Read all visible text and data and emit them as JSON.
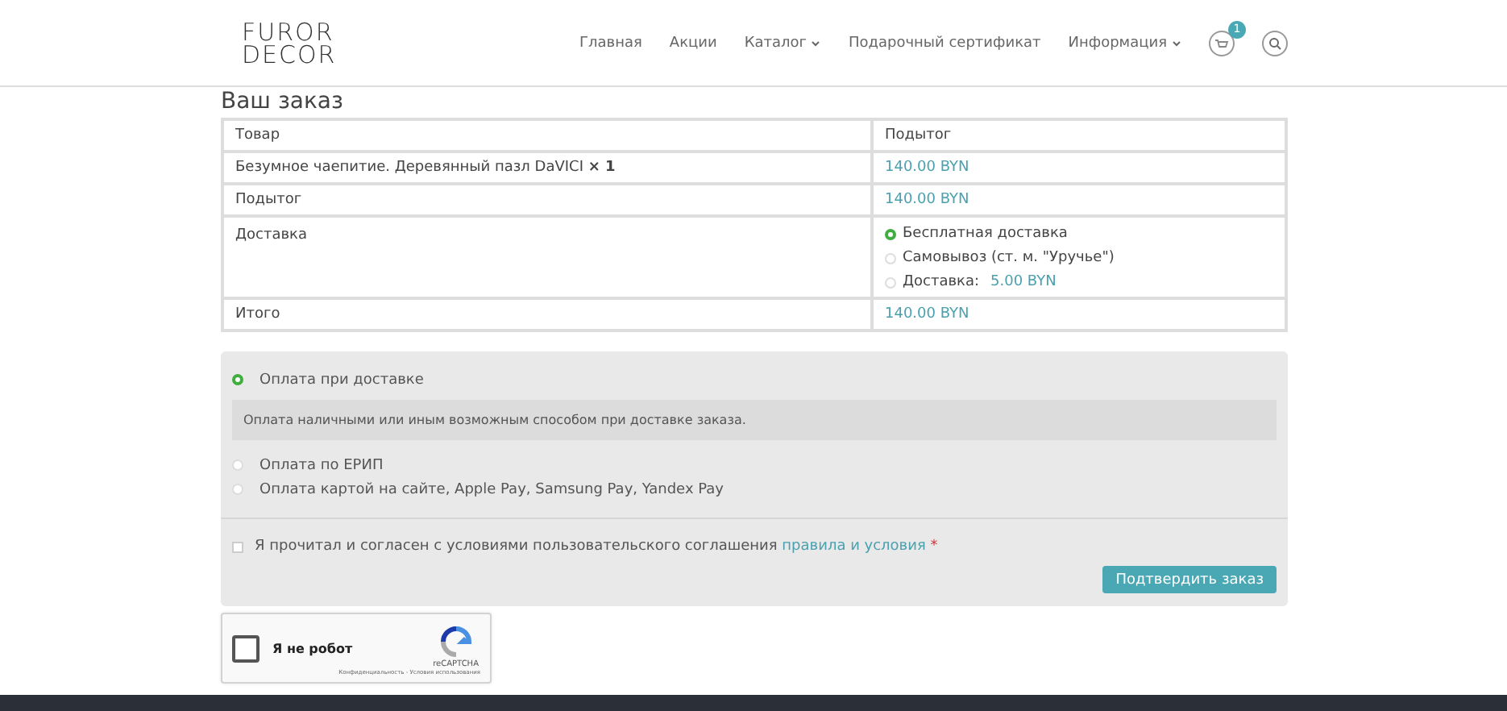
{
  "header": {
    "logo": [
      "FUROR",
      "DECOR"
    ],
    "nav": [
      {
        "label": "Главная",
        "dropdown": false
      },
      {
        "label": "Акции",
        "dropdown": false
      },
      {
        "label": "Каталог",
        "dropdown": true
      },
      {
        "label": "Подарочный сертификат",
        "dropdown": false
      },
      {
        "label": "Информация",
        "dropdown": true
      }
    ],
    "cart_count": "1"
  },
  "heading": "Ваш заказ",
  "order_table": {
    "columns": [
      "Товар",
      "Подытог"
    ],
    "item": {
      "name": "Безумное чаепитие. Деревянный пазл DaVICI",
      "qty": "× 1",
      "price": "140.00 BYN"
    },
    "subtotal": {
      "label": "Подытог",
      "value": "140.00 BYN"
    },
    "shipping": {
      "label": "Доставка",
      "options": [
        {
          "label": "Бесплатная доставка",
          "selected": true
        },
        {
          "label": "Самовывоз (ст. м. \"Уручье\")",
          "selected": false
        },
        {
          "label": "Доставка:",
          "price": "5.00 BYN",
          "selected": false
        }
      ]
    },
    "total": {
      "label": "Итого",
      "value": "140.00 BYN"
    }
  },
  "payment": {
    "methods": [
      {
        "label": "Оплата при доставке",
        "selected": true,
        "description": "Оплата наличными или иным возможным способом при доставке заказа."
      },
      {
        "label": "Оплата по ЕРИП",
        "selected": false
      },
      {
        "label": "Оплата картой на сайте, Apple Pay, Samsung Pay, Yandex Pay",
        "selected": false
      }
    ],
    "terms": {
      "text": "Я прочитал и согласен с условиями пользовательского соглашения",
      "link": "правила и условия",
      "required": "*",
      "checked": false
    },
    "submit": "Подтвердить заказ"
  },
  "captcha": {
    "label": "Я не робот",
    "brand": "reCAPTCHA",
    "links": "Конфиденциальность - Условия использования",
    "checked": false
  }
}
